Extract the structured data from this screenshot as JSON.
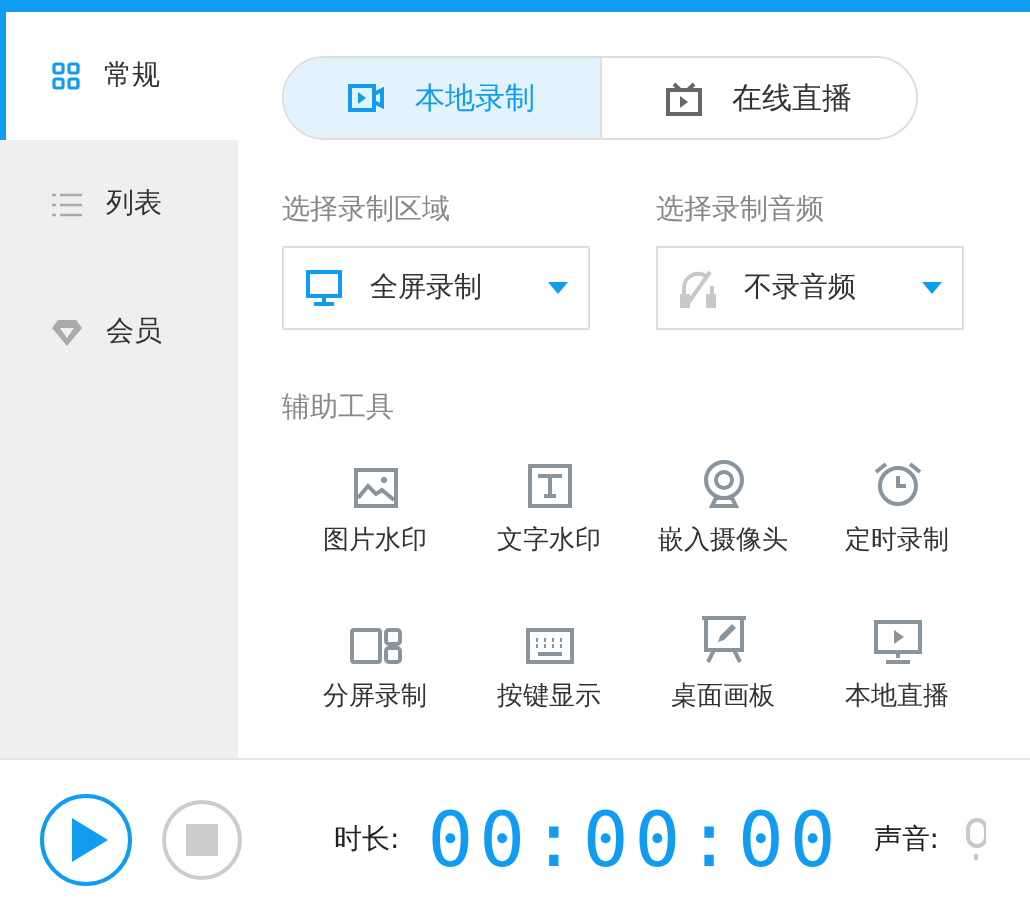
{
  "sidebar": {
    "items": [
      {
        "label": "常规",
        "kind": "grid",
        "selected": true
      },
      {
        "label": "列表",
        "kind": "list",
        "selected": false
      },
      {
        "label": "会员",
        "kind": "diamond",
        "selected": false
      }
    ]
  },
  "tabs": [
    {
      "label": "本地录制",
      "kind": "camera",
      "selected": true
    },
    {
      "label": "在线直播",
      "kind": "tv",
      "selected": false
    }
  ],
  "selectors": [
    {
      "label": "选择录制区域",
      "value": "全屏录制",
      "kind": "monitor"
    },
    {
      "label": "选择录制音频",
      "value": "不录音频",
      "kind": "mute"
    }
  ],
  "tools": {
    "title": "辅助工具",
    "items": [
      {
        "label": "图片水印",
        "kind": "image"
      },
      {
        "label": "文字水印",
        "kind": "text"
      },
      {
        "label": "嵌入摄像头",
        "kind": "webcam"
      },
      {
        "label": "定时录制",
        "kind": "alarm"
      },
      {
        "label": "分屏录制",
        "kind": "split"
      },
      {
        "label": "按键显示",
        "kind": "keyboard"
      },
      {
        "label": "桌面画板",
        "kind": "easel"
      },
      {
        "label": "本地直播",
        "kind": "screen-play"
      }
    ]
  },
  "footer": {
    "duration_label": "时长:",
    "timer": "00:00:00",
    "sound_label": "声音:"
  }
}
